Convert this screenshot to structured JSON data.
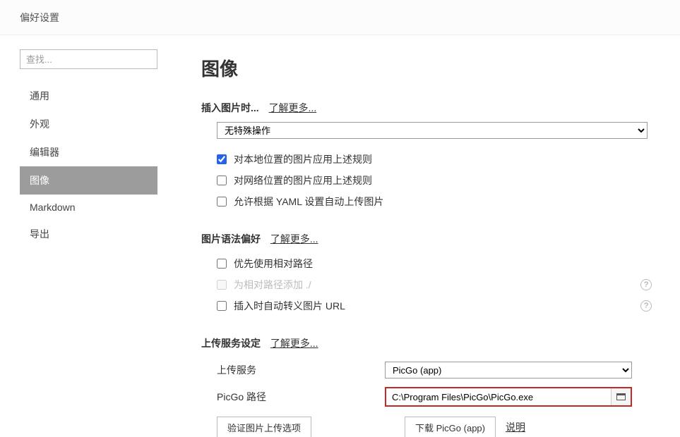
{
  "titlebar": {
    "title": "偏好设置"
  },
  "sidebar": {
    "search_placeholder": "查找...",
    "items": [
      {
        "label": "通用"
      },
      {
        "label": "外观"
      },
      {
        "label": "编辑器"
      },
      {
        "label": "图像"
      },
      {
        "label": "Markdown"
      },
      {
        "label": "导出"
      }
    ],
    "selected_index": 3
  },
  "main": {
    "heading": "图像",
    "section_insert": {
      "title": "插入图片时...",
      "learn_more": "了解更多...",
      "dropdown_value": "无特殊操作",
      "cb_local": "对本地位置的图片应用上述规则",
      "cb_network": "对网络位置的图片应用上述规则",
      "cb_yaml": "允许根据 YAML 设置自动上传图片"
    },
    "section_syntax": {
      "title": "图片语法偏好",
      "learn_more": "了解更多...",
      "cb_relative": "优先使用相对路径",
      "cb_prefix": "为相对路径添加 ./",
      "cb_escape": "插入时自动转义图片 URL"
    },
    "section_upload": {
      "title": "上传服务设定",
      "learn_more": "了解更多...",
      "label_service": "上传服务",
      "service_value": "PicGo (app)",
      "label_path": "PicGo 路径",
      "path_value": "C:\\Program Files\\PicGo\\PicGo.exe",
      "btn_validate": "验证图片上传选项",
      "btn_download": "下载 PicGo (app)",
      "link_help": "说明"
    }
  }
}
